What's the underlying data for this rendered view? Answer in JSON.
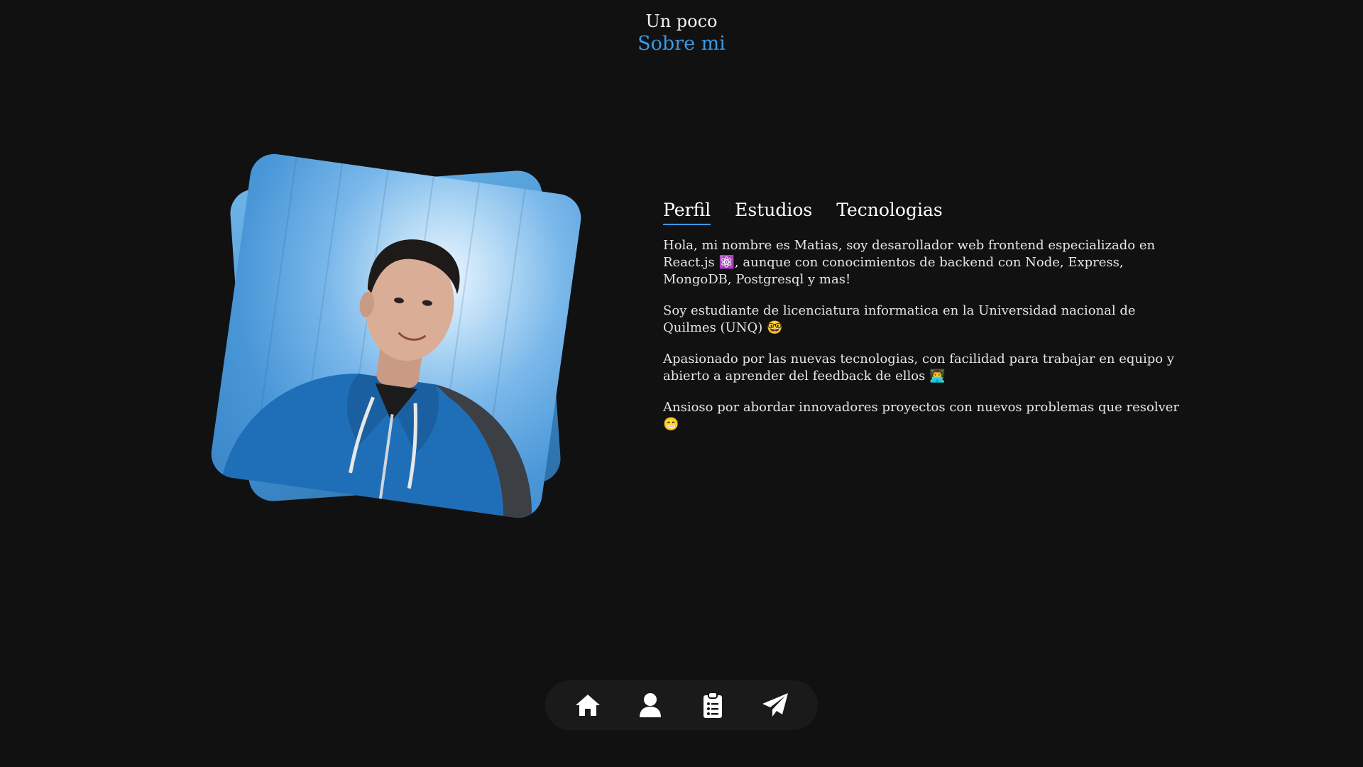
{
  "header": {
    "subtitle": "Un poco",
    "title": "Sobre mi"
  },
  "photo": {
    "alt": "Foto de perfil"
  },
  "tabs": [
    {
      "label": "Perfil",
      "active": true
    },
    {
      "label": "Estudios",
      "active": false
    },
    {
      "label": "Tecnologias",
      "active": false
    }
  ],
  "paragraphs": [
    {
      "text": "Hola, mi nombre es Matias, soy desarollador web frontend especializado en React.js ⚛️, aunque con conocimientos de backend con Node, Express, MongoDB, Postgresql y mas!"
    },
    {
      "text": "Soy estudiante de licenciatura informatica en la Universidad nacional de Quilmes (UNQ) 🤓"
    },
    {
      "text": "Apasionado por las nuevas tecnologias, con facilidad para trabajar en equipo y abierto a aprender del feedback de ellos 👨‍💻"
    },
    {
      "text": "Ansioso por abordar innovadores proyectos con nuevos problemas que resolver 😁"
    }
  ],
  "nav": [
    {
      "icon": "home-icon"
    },
    {
      "icon": "user-icon"
    },
    {
      "icon": "clipboard-list-icon"
    },
    {
      "icon": "paper-plane-icon"
    }
  ],
  "colors": {
    "background": "#111111",
    "accent": "#3a9ae6",
    "nav_bg": "#1a1a1a"
  }
}
